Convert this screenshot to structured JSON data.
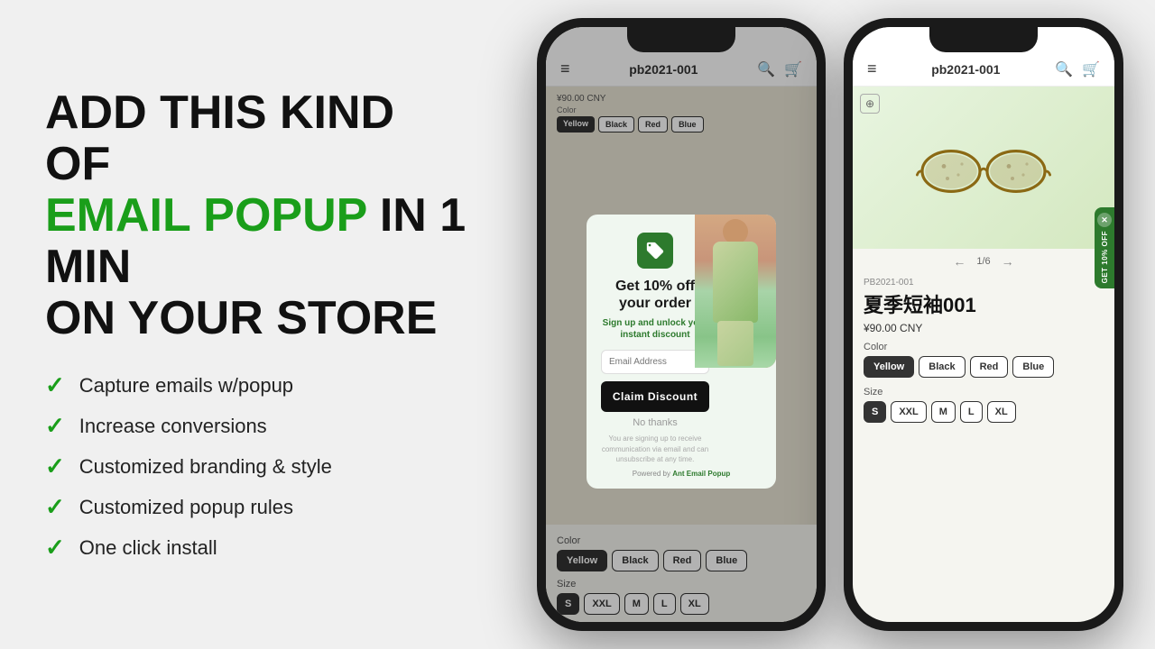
{
  "left": {
    "headline_line1": "ADD THIS KIND OF",
    "headline_line2_green": "EMAIL POPUP",
    "headline_line2_rest": " IN 1 MIN",
    "headline_line3": "ON YOUR STORE",
    "features": [
      "Capture emails w/popup",
      "Increase conversions",
      "Customized branding & style",
      "Customized popup rules",
      "One click install"
    ]
  },
  "phone1": {
    "header_title": "pb2021-001",
    "header_icon_menu": "≡",
    "header_icon_search": "🔍",
    "header_icon_cart": "🛒"
  },
  "popup": {
    "tag_icon": "🏷",
    "heading": "Get 10% off your order",
    "subtext": "Sign up and unlock your instant discount",
    "email_placeholder": "Email Address",
    "cta": "Claim Discount",
    "no_thanks": "No thanks",
    "disclaimer": "You are signing up to receive communication via email and can unsubscribe at any time.",
    "powered_by": "Powered by",
    "powered_link": "Ant Email Popup"
  },
  "phone1_product": {
    "price": "¥90.00 CNY",
    "color_label": "Color",
    "colors": [
      "Yellow",
      "Black",
      "Red",
      "Blue"
    ],
    "active_color": "Yellow",
    "size_label": "Size",
    "sizes": [
      "S",
      "XXL",
      "M",
      "L",
      "XL"
    ],
    "active_size": "S"
  },
  "phone2": {
    "header_title": "pb2021-001",
    "header_icon_menu": "≡",
    "header_icon_search": "🔍",
    "header_icon_cart": "🛒",
    "sku": "PB2021-001",
    "product_name": "夏季短袖001",
    "price": "¥90.00 CNY",
    "image_nav": "1/6",
    "color_label": "Color",
    "colors": [
      "Yellow",
      "Black",
      "Red",
      "Blue"
    ],
    "active_color": "Yellow",
    "size_label": "Size",
    "sizes": [
      "S",
      "XXL",
      "M",
      "L",
      "XL"
    ],
    "active_size": "S",
    "side_tab": "GET 10% OFF"
  }
}
